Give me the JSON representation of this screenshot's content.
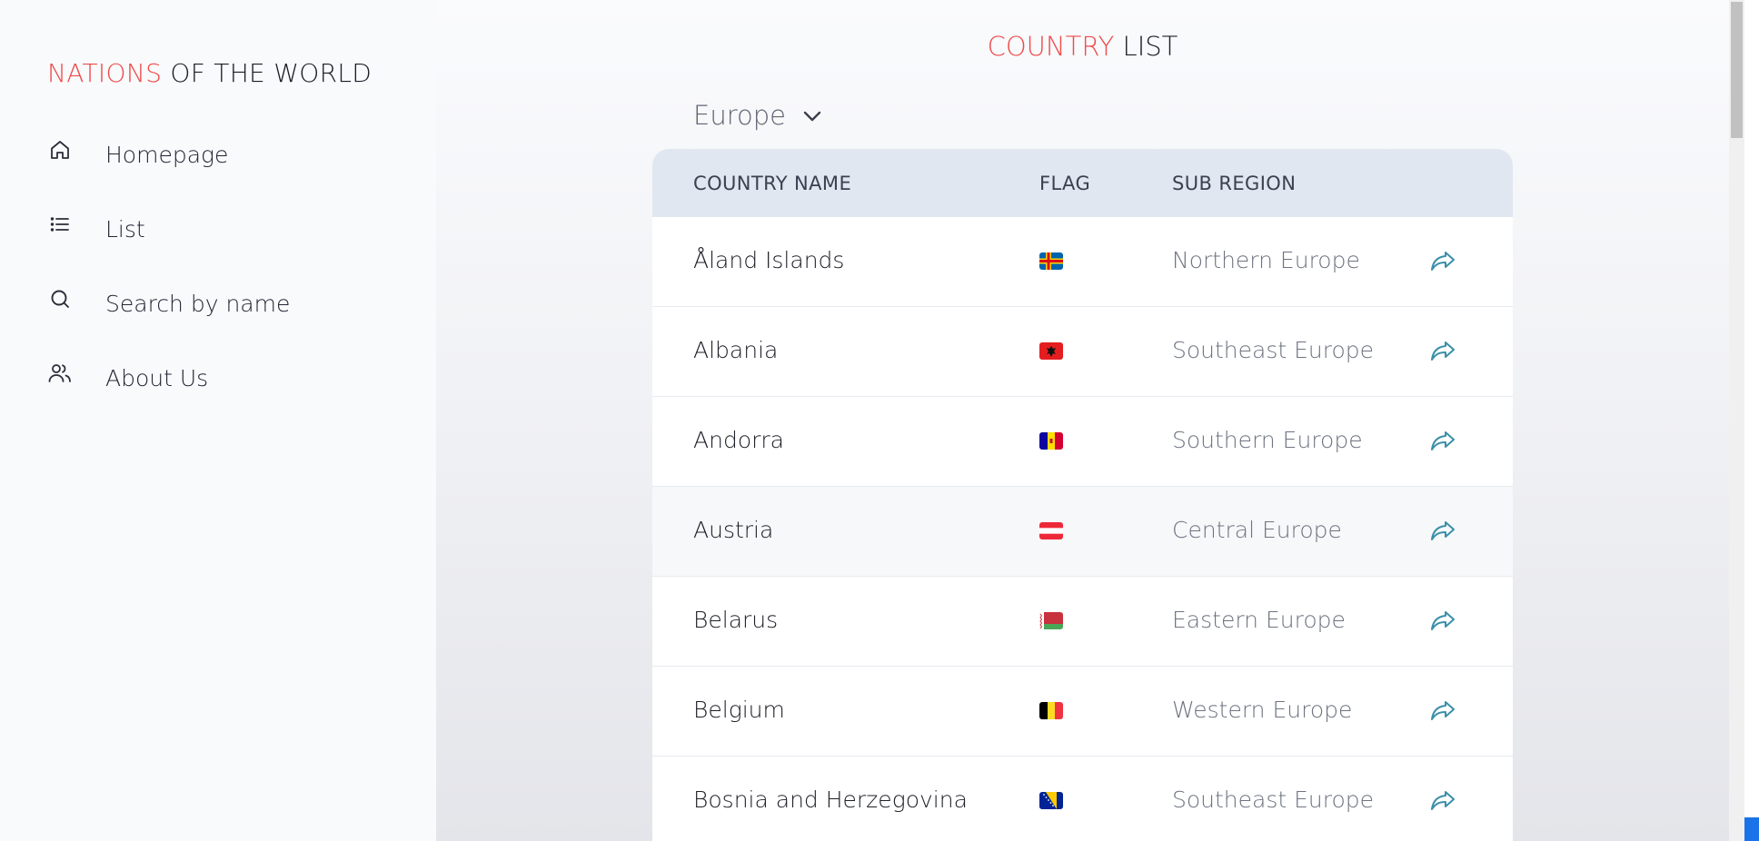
{
  "sidebar": {
    "brand": {
      "accent": "NATIONS",
      "rest": " OF THE WORLD"
    },
    "items": [
      {
        "label": "Homepage",
        "icon": "home-icon"
      },
      {
        "label": "List",
        "icon": "list-icon"
      },
      {
        "label": "Search by name",
        "icon": "search-icon"
      },
      {
        "label": "About Us",
        "icon": "users-icon"
      }
    ]
  },
  "main": {
    "title": {
      "accent": "COUNTRY",
      "rest": " LIST"
    },
    "region_select": {
      "value": "Europe",
      "icon": "chevron-down-icon"
    },
    "table": {
      "headers": {
        "name": "COUNTRY NAME",
        "flag": "FLAG",
        "sub_region": "SUB REGION"
      },
      "rows": [
        {
          "name": "Åland Islands",
          "sub_region": "Northern Europe",
          "flag": "aland-flag"
        },
        {
          "name": "Albania",
          "sub_region": "Southeast Europe",
          "flag": "albania-flag"
        },
        {
          "name": "Andorra",
          "sub_region": "Southern Europe",
          "flag": "andorra-flag"
        },
        {
          "name": "Austria",
          "sub_region": "Central Europe",
          "flag": "austria-flag"
        },
        {
          "name": "Belarus",
          "sub_region": "Eastern Europe",
          "flag": "belarus-flag"
        },
        {
          "name": "Belgium",
          "sub_region": "Western Europe",
          "flag": "belgium-flag"
        },
        {
          "name": "Bosnia and Herzegovina",
          "sub_region": "Southeast Europe",
          "flag": "bosnia-flag"
        }
      ]
    }
  },
  "colors": {
    "accent": "#ef4b4b",
    "header_bg": "#e1e7f0",
    "link_icon": "#3a8fa8",
    "sidebar_bg": "#f9fafc"
  }
}
